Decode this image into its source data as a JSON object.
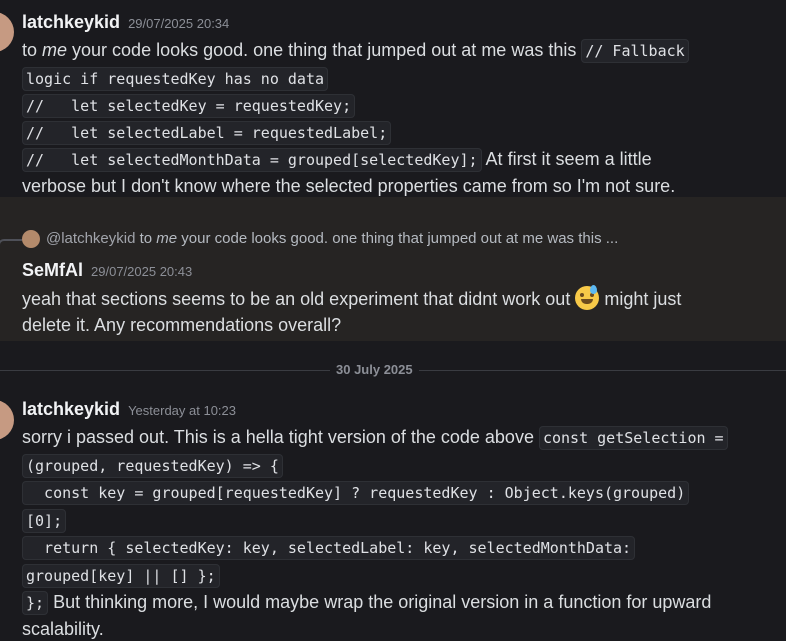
{
  "messages": [
    {
      "author": "latchkeykid",
      "timestamp": "29/07/2025 20:34",
      "lines": [
        {
          "pre": "to ",
          "em": "me",
          "post": " your code looks good. one thing that jumped out at me was this ",
          "code": "// Fallback"
        },
        {
          "code": "logic if requestedKey has no data"
        },
        {
          "code": "//   let selectedKey = requestedKey;"
        },
        {
          "code": "//   let selectedLabel = requestedLabel;"
        },
        {
          "code": "//   let selectedMonthData = grouped[selectedKey];",
          "post": " At first it seem a little"
        },
        {
          "text": "verbose but I don't know where the selected properties came from so I'm not sure."
        }
      ]
    },
    {
      "reply_to": {
        "name": "@latchkeykid",
        "pre": " to ",
        "em": "me",
        "post": " your code looks good. one thing that jumped out at me was this ..."
      },
      "author": "SeMfAl",
      "timestamp": "29/07/2025 20:43",
      "lines": [
        {
          "pre": "yeah that sections seems to be an old experiment that didnt work out ",
          "emoji": "sweat-smile-emoji",
          "post": " might just"
        },
        {
          "text": "delete it. Any recommendations overall?"
        }
      ]
    },
    {
      "author": "latchkeykid",
      "timestamp": "Yesterday at 10:23",
      "lines": [
        {
          "pre": "sorry i passed out. This is a hella tight version of the code above ",
          "code": "const getSelection ="
        },
        {
          "code": "(grouped, requestedKey) => {"
        },
        {
          "code": "  const key = grouped[requestedKey] ? requestedKey : Object.keys(grouped)"
        },
        {
          "code": "[0];"
        },
        {
          "code": "  return { selectedKey: key, selectedLabel: key, selectedMonthData:"
        },
        {
          "code": "grouped[key] || [] };"
        },
        {
          "code": "};",
          "post": " But thinking more, I would maybe wrap the original version in a function for upward"
        },
        {
          "text": "scalability."
        }
      ]
    }
  ],
  "date_divider": "30 July 2025"
}
